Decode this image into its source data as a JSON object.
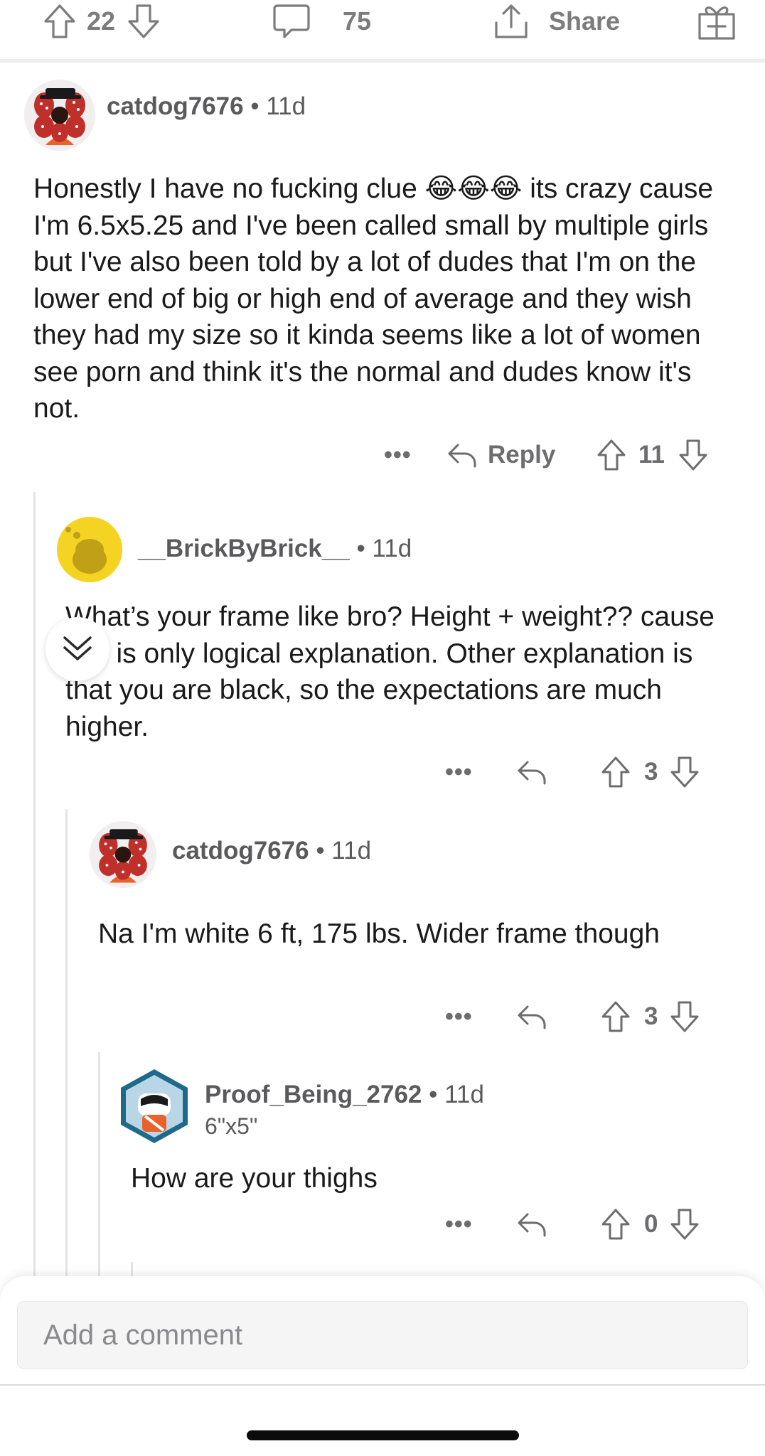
{
  "topbar": {
    "upvotes": "22",
    "comments": "75",
    "share_label": "Share"
  },
  "comments": [
    {
      "username": "catdog7676",
      "meta": " • 11d",
      "body": "Honestly I have no fucking clue 😂😂😂 its crazy cause I'm 6.5x5.25 and I've been called small by multiple girls but I've also been told by a lot of dudes that I'm on the lower end of big or high end of average and they wish they had my size so it kinda seems like a lot of women see porn and think it's the normal and dudes know it's not.",
      "reply_label": "Reply",
      "score": "11"
    },
    {
      "username": "__BrickByBrick__",
      "meta": " • 11d",
      "body": "What’s your frame like bro? Height + weight?? cause this is only logical explanation. Other explanation is that you are black, so the expectations are much higher.",
      "score": "3"
    },
    {
      "username": "catdog7676",
      "meta": " • 11d",
      "body": "Na I'm white 6 ft, 175 lbs. Wider frame though",
      "score": "3"
    },
    {
      "username": "Proof_Being_2762",
      "meta": " • 11d",
      "flair": "6\"x5\"",
      "body": "How are your thighs",
      "score": "0"
    }
  ],
  "composer": {
    "placeholder": "Add a comment"
  },
  "colors": {
    "text_primary": "#1a1a1b",
    "text_secondary": "#6d6d6f",
    "thread_line": "#e4e4e6",
    "input_bg": "#f5f5f6"
  }
}
